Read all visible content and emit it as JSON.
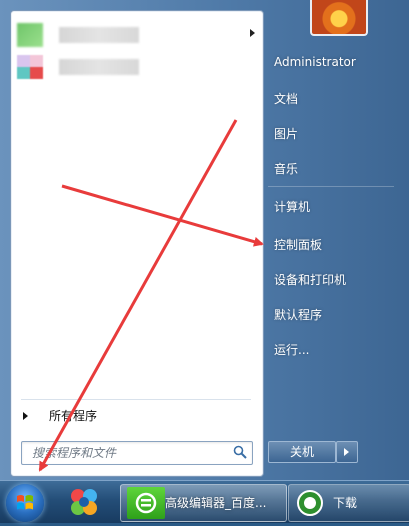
{
  "left_pane": {
    "recent_items": [
      {
        "icon": "blurred-app-icon-green"
      },
      {
        "icon": "blurred-app-icon-multi"
      }
    ],
    "all_programs_label": "所有程序",
    "search": {
      "placeholder": "搜索程序和文件"
    }
  },
  "right_pane": {
    "user_name": "Administrator",
    "items": [
      {
        "label": "文档"
      },
      {
        "label": "图片"
      },
      {
        "label": "音乐"
      },
      {
        "label": "计算机"
      },
      {
        "label": "控制面板"
      },
      {
        "label": "设备和打印机"
      },
      {
        "label": "默认程序"
      },
      {
        "label": "运行..."
      }
    ],
    "shutdown_label": "关机"
  },
  "taskbar": {
    "active_window_label": "高级编辑器_百度...",
    "second_window_label": "下载"
  },
  "colors": {
    "annotation_arrow": "#e83b3b",
    "menu_frame": "#4f7aa8",
    "left_pane": "#ffffff"
  }
}
